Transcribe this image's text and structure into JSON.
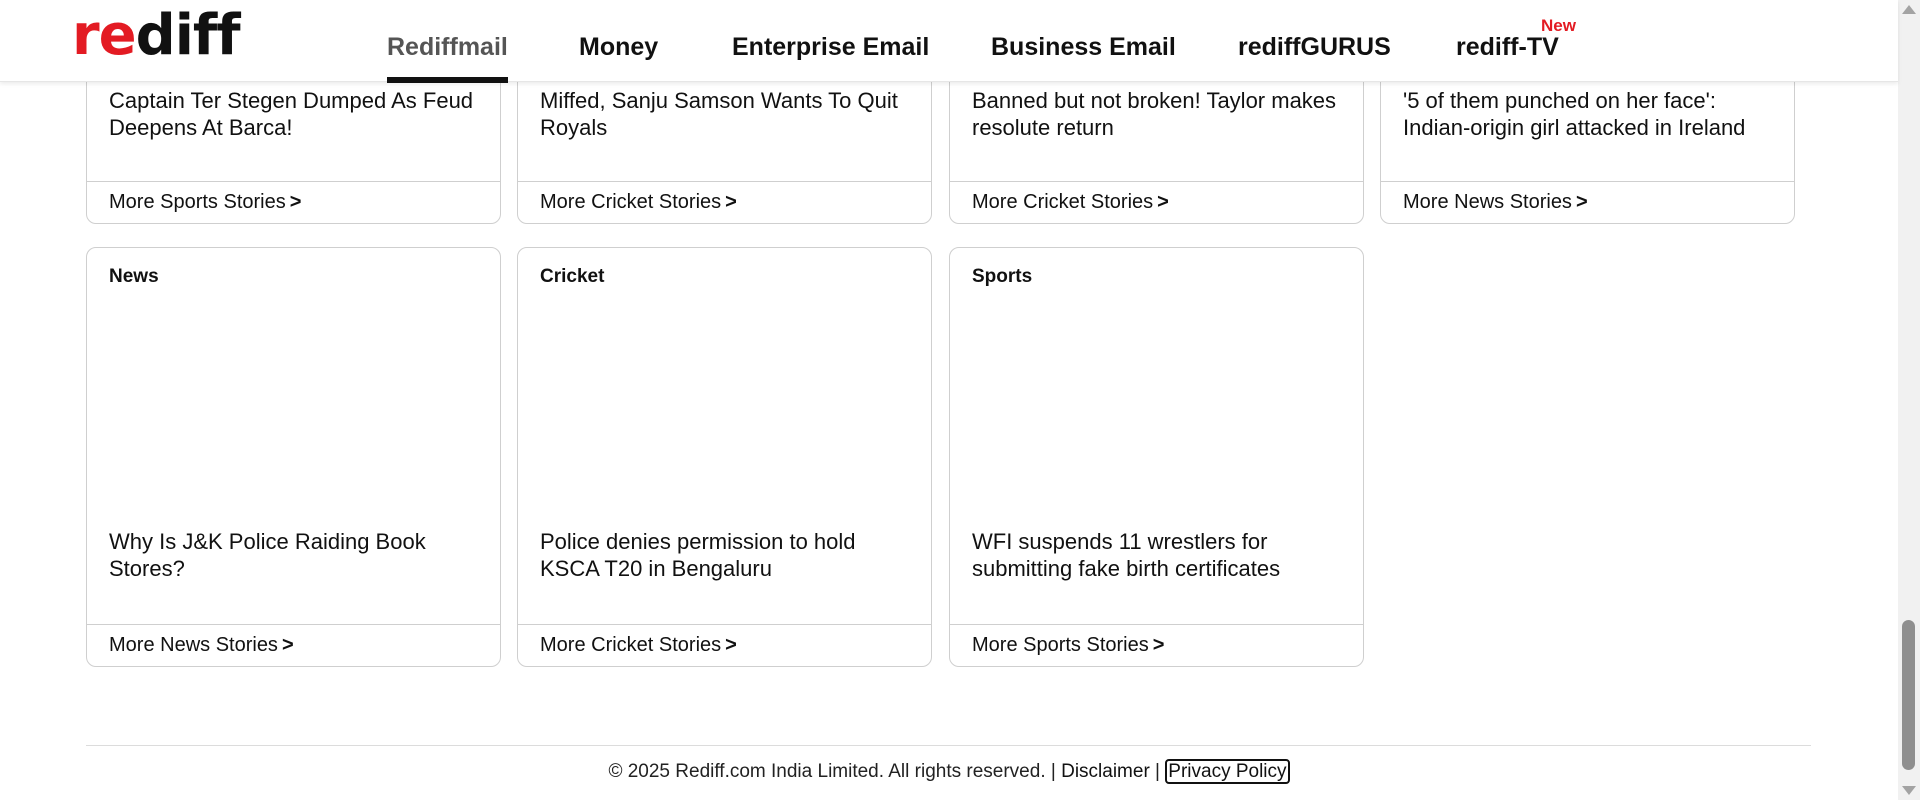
{
  "header": {
    "logo": {
      "part1": "re",
      "part2": "diff"
    },
    "nav": [
      {
        "label": "Rediffmail",
        "active": true
      },
      {
        "label": "Money"
      },
      {
        "label": "Enterprise Email"
      },
      {
        "label": "Business Email"
      },
      {
        "label": "rediffGURUS"
      },
      {
        "label": "rediff-TV",
        "badge": "New"
      }
    ]
  },
  "cards_row1": [
    {
      "headline": "Captain Ter Stegen Dumped As Feud Deepens At Barca!",
      "more": "More Sports Stories"
    },
    {
      "headline": "Miffed, Sanju Samson Wants To Quit Royals",
      "more": "More Cricket Stories"
    },
    {
      "headline": "Banned but not broken! Taylor makes resolute return",
      "more": "More Cricket Stories"
    },
    {
      "headline": "'5 of them punched on her face': Indian-origin girl attacked in Ireland",
      "more": "More News Stories"
    }
  ],
  "cards_row2": [
    {
      "category": "News",
      "headline": "Why Is J&K Police Raiding Book Stores?",
      "more": "More News Stories"
    },
    {
      "category": "Cricket",
      "headline": "Police denies permission to hold KSCA T20 in Bengaluru",
      "more": "More Cricket Stories"
    },
    {
      "category": "Sports",
      "headline": "WFI suspends 11 wrestlers for submitting fake birth certificates",
      "more": "More Sports Stories"
    }
  ],
  "more_arrow": ">",
  "footer": {
    "copyright": "© 2025 Rediff.com India Limited. All rights reserved. | ",
    "disclaimer": "Disclaimer",
    "separator": " | ",
    "privacy": "Privacy Policy"
  },
  "colors": {
    "brand_red": "#e31b23",
    "text": "#111111",
    "border": "#cfcfcf"
  }
}
